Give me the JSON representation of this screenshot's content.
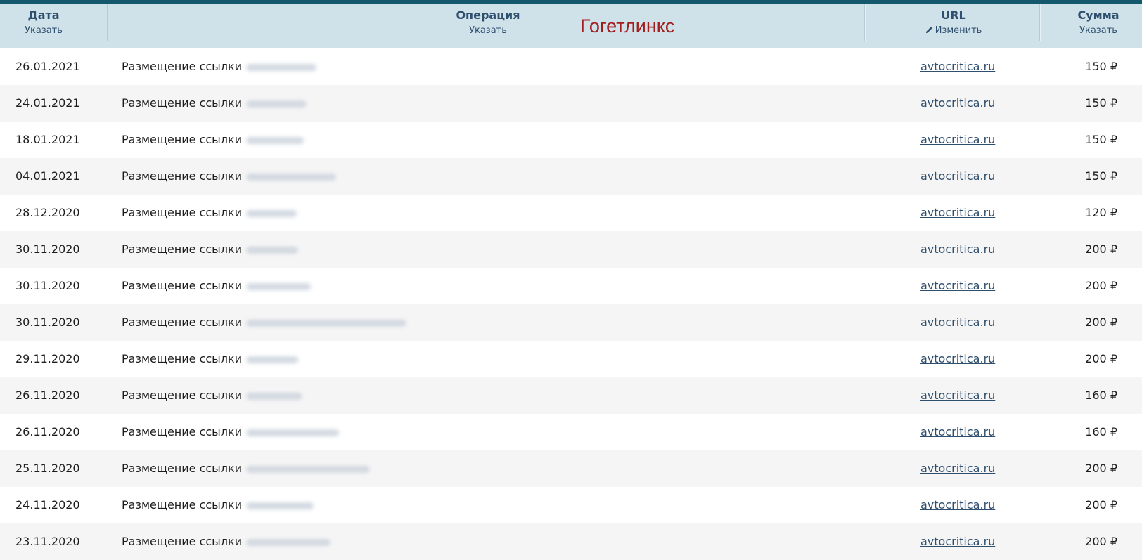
{
  "brand": "Гогетлинкс",
  "header": {
    "date": {
      "title": "Дата",
      "action": "Указать"
    },
    "operation": {
      "title": "Операция",
      "action": "Указать"
    },
    "url": {
      "title": "URL",
      "action": "Изменить"
    },
    "sum": {
      "title": "Сумма",
      "action": "Указать"
    }
  },
  "colors": {
    "top_strip": "#14586e",
    "header_bg": "#cfe2ea",
    "header_text": "#2f4f6f",
    "brand": "#a41d1d",
    "row_alt": "#f5f5f5"
  },
  "rows": [
    {
      "date": "26.01.2021",
      "operation": "Размещение ссылки",
      "url": "avtocritica.ru",
      "sum": "150 ₽"
    },
    {
      "date": "24.01.2021",
      "operation": "Размещение ссылки",
      "url": "avtocritica.ru",
      "sum": "150 ₽"
    },
    {
      "date": "18.01.2021",
      "operation": "Размещение ссылки",
      "url": "avtocritica.ru",
      "sum": "150 ₽"
    },
    {
      "date": "04.01.2021",
      "operation": "Размещение ссылки",
      "url": "avtocritica.ru",
      "sum": "150 ₽"
    },
    {
      "date": "28.12.2020",
      "operation": "Размещение ссылки",
      "url": "avtocritica.ru",
      "sum": "120 ₽"
    },
    {
      "date": "30.11.2020",
      "operation": "Размещение ссылки",
      "url": "avtocritica.ru",
      "sum": "200 ₽"
    },
    {
      "date": "30.11.2020",
      "operation": "Размещение ссылки",
      "url": "avtocritica.ru",
      "sum": "200 ₽"
    },
    {
      "date": "30.11.2020",
      "operation": "Размещение ссылки",
      "url": "avtocritica.ru",
      "sum": "200 ₽"
    },
    {
      "date": "29.11.2020",
      "operation": "Размещение ссылки",
      "url": "avtocritica.ru",
      "sum": "200 ₽"
    },
    {
      "date": "26.11.2020",
      "operation": "Размещение ссылки",
      "url": "avtocritica.ru",
      "sum": "160 ₽"
    },
    {
      "date": "26.11.2020",
      "operation": "Размещение ссылки",
      "url": "avtocritica.ru",
      "sum": "160 ₽"
    },
    {
      "date": "25.11.2020",
      "operation": "Размещение ссылки",
      "url": "avtocritica.ru",
      "sum": "200 ₽"
    },
    {
      "date": "24.11.2020",
      "operation": "Размещение ссылки",
      "url": "avtocritica.ru",
      "sum": "200 ₽"
    },
    {
      "date": "23.11.2020",
      "operation": "Размещение ссылки",
      "url": "avtocritica.ru",
      "sum": "200 ₽"
    }
  ]
}
